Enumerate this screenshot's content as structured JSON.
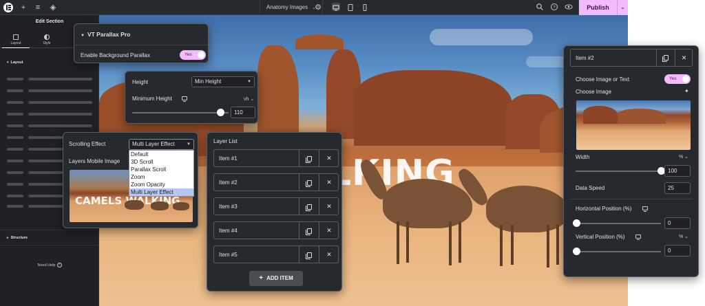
{
  "topbar": {
    "page_title": "Anatomy Images",
    "publish_label": "Publish",
    "icons": [
      "elementor-logo-icon",
      "plus-icon",
      "sliders-icon",
      "layers-icon",
      "gear-icon",
      "desktop-icon",
      "tablet-icon",
      "mobile-icon",
      "search-icon",
      "help-icon",
      "eye-icon",
      "chevron-down-icon"
    ]
  },
  "left_panel": {
    "title": "Edit Section",
    "tabs": [
      {
        "label": "Layout"
      },
      {
        "label": "Style"
      }
    ],
    "section_layout": "Layout",
    "section_structure": "Structure",
    "need_help": "Need Help"
  },
  "parallax_panel": {
    "title": "VT Parallax Pro",
    "enable_label": "Enable Background Parallax",
    "enable_value": "Yes"
  },
  "height_panel": {
    "height_label": "Height",
    "height_value": "Min Height",
    "min_height_label": "Minimum Height",
    "unit": "vh",
    "value": "110",
    "slider_fraction": 0.92
  },
  "scroll_panel": {
    "effect_label": "Scrolling Effect",
    "effect_value": "Multi Layer Effect",
    "mobile_label": "Layers Mobile Image",
    "options": [
      "Default",
      "3D Scroll",
      "Parallax Scroll",
      "Zoom",
      "Zoom Opacity",
      "Multi Layer Effect"
    ],
    "thumb_text": "CAMELS WALKING"
  },
  "layer_panel": {
    "title": "Layer List",
    "items": [
      {
        "label": "Item #1"
      },
      {
        "label": "Item #2"
      },
      {
        "label": "Item #3"
      },
      {
        "label": "Item #4"
      },
      {
        "label": "Item #5"
      }
    ],
    "add_label": "ADD ITEM"
  },
  "canvas": {
    "overlay_text": "S WALKING"
  },
  "item_panel": {
    "title": "Item #2",
    "choose_label": "Choose Image or Text",
    "choose_value": "Yes",
    "image_label": "Choose Image",
    "width_label": "Width",
    "width_unit": "%",
    "width_value": "100",
    "width_fraction": 1.0,
    "speed_label": "Data Speed",
    "speed_value": "25",
    "hpos_label": "Horizontal Position (%)",
    "hpos_value": "0",
    "vpos_label": "Vertical Position (%)",
    "vpos_unit": "%",
    "vpos_value": "0"
  },
  "colors": {
    "accent": "#f3bafd",
    "panel_bg": "#26292d",
    "sidebar_bg": "#1f2124"
  }
}
